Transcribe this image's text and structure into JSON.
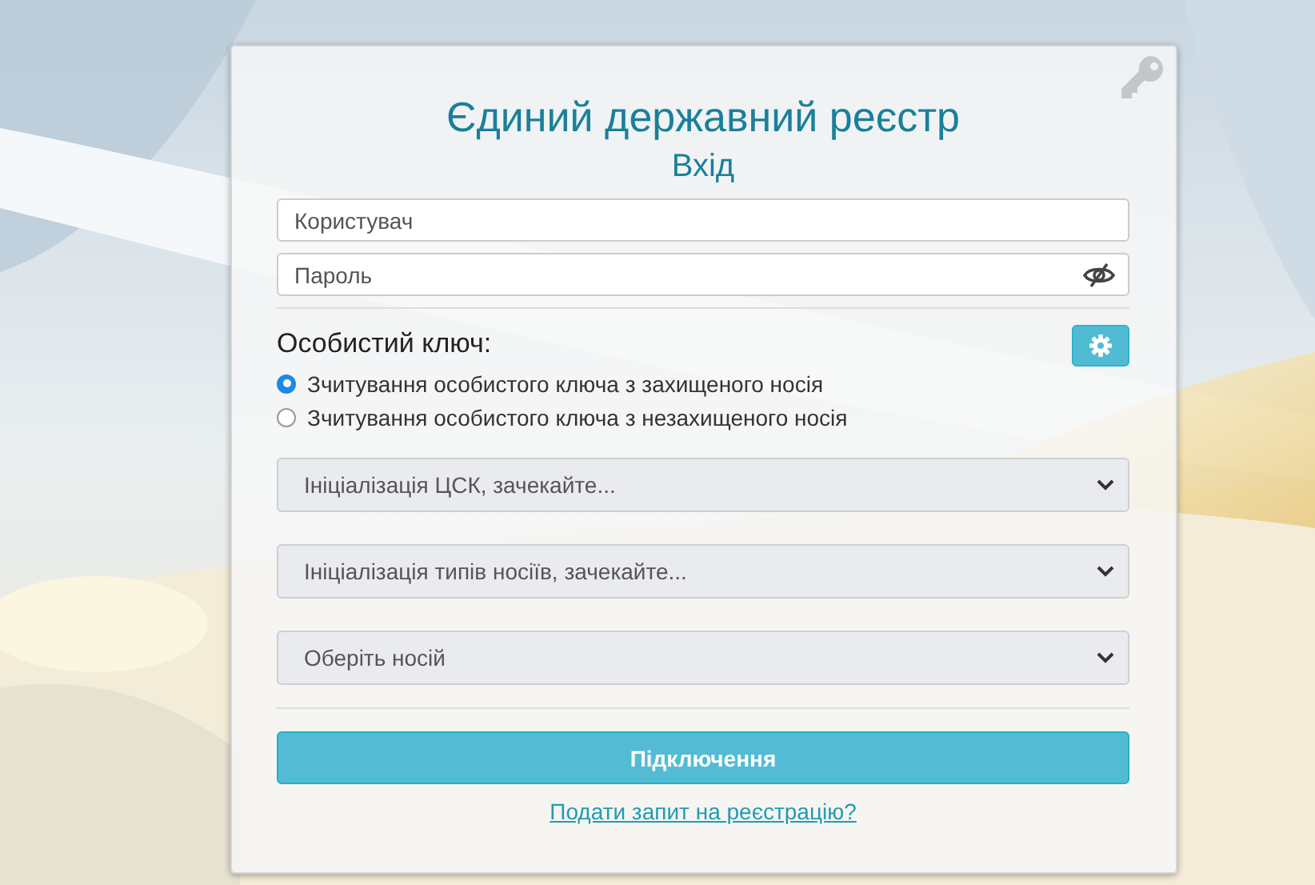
{
  "title": "Єдиний державний реєстр",
  "subtitle": "Вхід",
  "username": {
    "placeholder": "Користувач"
  },
  "password": {
    "placeholder": "Пароль"
  },
  "key_section": {
    "label": "Особистий ключ:",
    "options": [
      {
        "label": "Зчитування особистого ключа з захищеного носія",
        "selected": true
      },
      {
        "label": "Зчитування особистого ключа з незахищеного носія",
        "selected": false
      }
    ]
  },
  "selects": [
    {
      "value": "Ініціалізація ЦСК, зачекайте..."
    },
    {
      "value": "Ініціалізація типів носіїв, зачекайте..."
    },
    {
      "value": "Оберіть носій"
    }
  ],
  "connect_button": "Підключення",
  "register_link": "Подати запит на реєстрацію?"
}
